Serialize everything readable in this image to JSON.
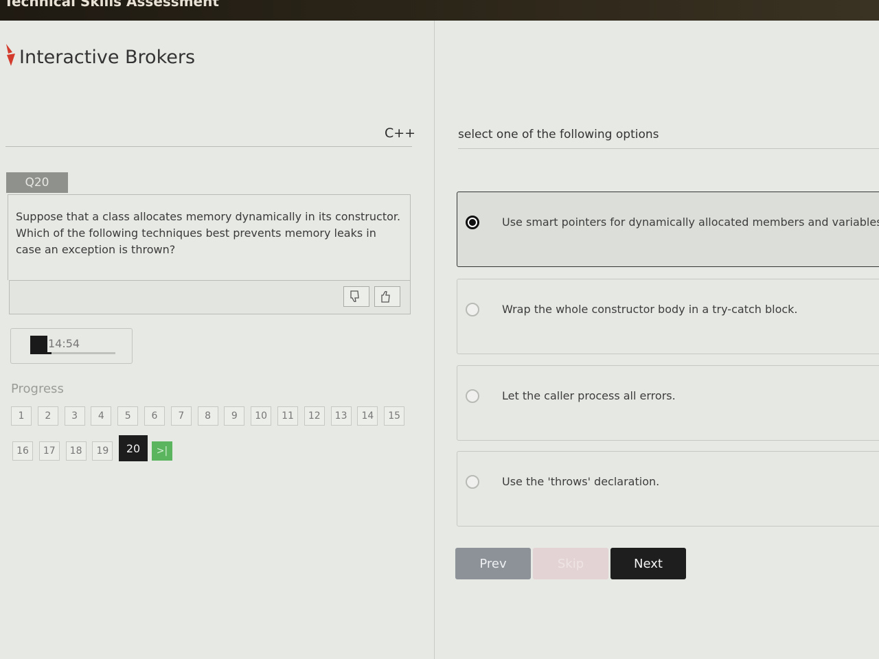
{
  "window": {
    "title": "Technical Skills Assessment"
  },
  "brand": {
    "name": "Interactive Brokers"
  },
  "question": {
    "language": "C++",
    "number_label": "Q20",
    "text": "Suppose that a class allocates memory dynamically in its constructor.  Which of the following techniques best prevents memory leaks in case an exception is thrown?"
  },
  "feedback": {
    "dislike_icon": "thumbs-down-icon",
    "like_icon": "thumbs-up-icon"
  },
  "timer": {
    "value": "14:54",
    "fraction_elapsed": 0.25
  },
  "progress": {
    "label": "Progress",
    "row1": [
      "1",
      "2",
      "3",
      "4",
      "5",
      "6",
      "7",
      "8",
      "9",
      "10",
      "11",
      "12",
      "13",
      "14",
      "15"
    ],
    "row2": [
      "16",
      "17",
      "18",
      "19"
    ],
    "current": "20",
    "last_label": ">|"
  },
  "answers": {
    "instruction": "select one of the following options",
    "options": [
      {
        "text": "Use smart pointers for dynamically allocated members and variables.",
        "selected": true
      },
      {
        "text": "Wrap the whole constructor body in a try-catch block.",
        "selected": false
      },
      {
        "text": "Let the caller process all errors.",
        "selected": false
      },
      {
        "text": "Use the 'throws' declaration.",
        "selected": false
      }
    ]
  },
  "nav": {
    "prev": "Prev",
    "skip": "Skip",
    "next": "Next"
  },
  "colors": {
    "brand_red": "#d33b2c",
    "next_bg": "#1e1e1e",
    "prev_bg": "#8d9299",
    "last_page_green": "#5bb55f"
  }
}
